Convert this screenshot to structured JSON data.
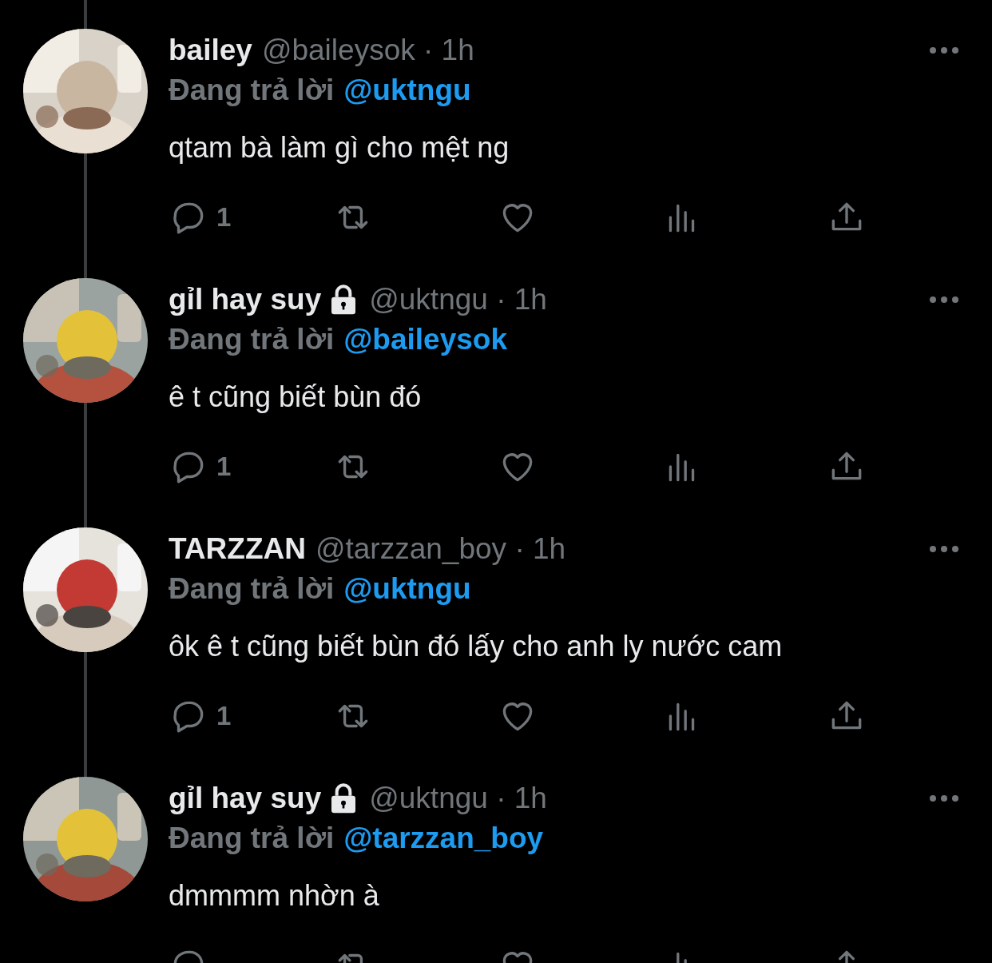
{
  "tweets": [
    {
      "name": "bailey",
      "locked": false,
      "handle": "@baileysok",
      "dot": "·",
      "time": "1h",
      "replying_label": "Đang trả lời",
      "replying_to": "@uktngu",
      "text": "qtam bà làm gì cho mệt ng",
      "reply_count": "1"
    },
    {
      "name": "gỉl hay suy",
      "locked": true,
      "handle": "@uktngu",
      "dot": "·",
      "time": "1h",
      "replying_label": "Đang trả lời",
      "replying_to": "@baileysok",
      "text": "ê t cũng biết bùn đó",
      "reply_count": "1"
    },
    {
      "name": "TARZZAN",
      "locked": false,
      "handle": "@tarzzan_boy",
      "dot": "·",
      "time": "1h",
      "replying_label": "Đang trả lời",
      "replying_to": "@uktngu",
      "text": "ôk ê t cũng biết bùn đó lấy cho anh ly nước cam",
      "reply_count": "1"
    },
    {
      "name": "gỉl hay suy",
      "locked": true,
      "handle": "@uktngu",
      "dot": "·",
      "time": "1h",
      "replying_label": "Đang trả lời",
      "replying_to": "@tarzzan_boy",
      "text": "dmmmm nhờn à"
    }
  ]
}
